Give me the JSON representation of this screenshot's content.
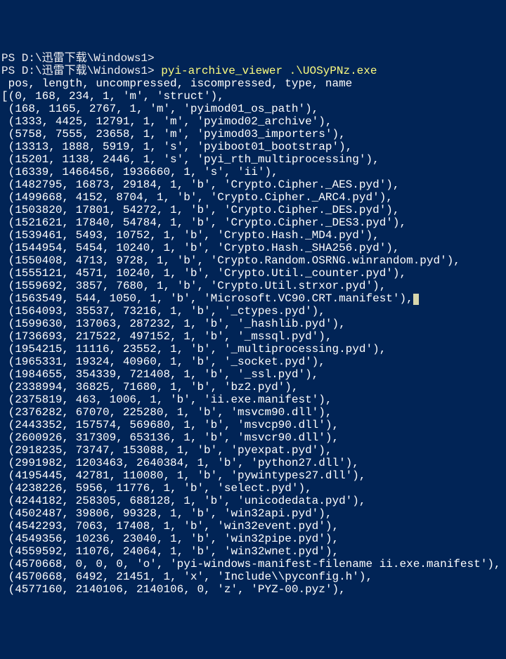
{
  "title_fragment": "PS D:\\迅雷下载\\Windows1>",
  "prompt": {
    "prefix": "PS D:\\迅雷下载\\Windows1>",
    "command": "pyi-archive_viewer .\\UOSyPNz.exe"
  },
  "header": " pos, length, uncompressed, iscompressed, type, name",
  "rows": [
    {
      "p": 0,
      "l": 168,
      "u": 234,
      "c": 1,
      "t": "m",
      "n": "struct"
    },
    {
      "p": 168,
      "l": 1165,
      "u": 2767,
      "c": 1,
      "t": "m",
      "n": "pyimod01_os_path"
    },
    {
      "p": 1333,
      "l": 4425,
      "u": 12791,
      "c": 1,
      "t": "m",
      "n": "pyimod02_archive"
    },
    {
      "p": 5758,
      "l": 7555,
      "u": 23658,
      "c": 1,
      "t": "m",
      "n": "pyimod03_importers"
    },
    {
      "p": 13313,
      "l": 1888,
      "u": 5919,
      "c": 1,
      "t": "s",
      "n": "pyiboot01_bootstrap"
    },
    {
      "p": 15201,
      "l": 1138,
      "u": 2446,
      "c": 1,
      "t": "s",
      "n": "pyi_rth_multiprocessing"
    },
    {
      "p": 16339,
      "l": 1466456,
      "u": 1936660,
      "c": 1,
      "t": "s",
      "n": "ii"
    },
    {
      "p": 1482795,
      "l": 16873,
      "u": 29184,
      "c": 1,
      "t": "b",
      "n": "Crypto.Cipher._AES.pyd"
    },
    {
      "p": 1499668,
      "l": 4152,
      "u": 8704,
      "c": 1,
      "t": "b",
      "n": "Crypto.Cipher._ARC4.pyd"
    },
    {
      "p": 1503820,
      "l": 17801,
      "u": 54272,
      "c": 1,
      "t": "b",
      "n": "Crypto.Cipher._DES.pyd"
    },
    {
      "p": 1521621,
      "l": 17840,
      "u": 54784,
      "c": 1,
      "t": "b",
      "n": "Crypto.Cipher._DES3.pyd"
    },
    {
      "p": 1539461,
      "l": 5493,
      "u": 10752,
      "c": 1,
      "t": "b",
      "n": "Crypto.Hash._MD4.pyd"
    },
    {
      "p": 1544954,
      "l": 5454,
      "u": 10240,
      "c": 1,
      "t": "b",
      "n": "Crypto.Hash._SHA256.pyd"
    },
    {
      "p": 1550408,
      "l": 4713,
      "u": 9728,
      "c": 1,
      "t": "b",
      "n": "Crypto.Random.OSRNG.winrandom.pyd"
    },
    {
      "p": 1555121,
      "l": 4571,
      "u": 10240,
      "c": 1,
      "t": "b",
      "n": "Crypto.Util._counter.pyd"
    },
    {
      "p": 1559692,
      "l": 3857,
      "u": 7680,
      "c": 1,
      "t": "b",
      "n": "Crypto.Util.strxor.pyd"
    },
    {
      "p": 1563549,
      "l": 544,
      "u": 1050,
      "c": 1,
      "t": "b",
      "n": "Microsoft.VC90.CRT.manifest",
      "cursor": true
    },
    {
      "p": 1564093,
      "l": 35537,
      "u": 73216,
      "c": 1,
      "t": "b",
      "n": "_ctypes.pyd"
    },
    {
      "p": 1599630,
      "l": 137063,
      "u": 287232,
      "c": 1,
      "t": "b",
      "n": "_hashlib.pyd"
    },
    {
      "p": 1736693,
      "l": 217522,
      "u": 497152,
      "c": 1,
      "t": "b",
      "n": "_mssql.pyd"
    },
    {
      "p": 1954215,
      "l": 11116,
      "u": 23552,
      "c": 1,
      "t": "b",
      "n": "_multiprocessing.pyd"
    },
    {
      "p": 1965331,
      "l": 19324,
      "u": 40960,
      "c": 1,
      "t": "b",
      "n": "_socket.pyd"
    },
    {
      "p": 1984655,
      "l": 354339,
      "u": 721408,
      "c": 1,
      "t": "b",
      "n": "_ssl.pyd"
    },
    {
      "p": 2338994,
      "l": 36825,
      "u": 71680,
      "c": 1,
      "t": "b",
      "n": "bz2.pyd"
    },
    {
      "p": 2375819,
      "l": 463,
      "u": 1006,
      "c": 1,
      "t": "b",
      "n": "ii.exe.manifest"
    },
    {
      "p": 2376282,
      "l": 67070,
      "u": 225280,
      "c": 1,
      "t": "b",
      "n": "msvcm90.dll"
    },
    {
      "p": 2443352,
      "l": 157574,
      "u": 569680,
      "c": 1,
      "t": "b",
      "n": "msvcp90.dll"
    },
    {
      "p": 2600926,
      "l": 317309,
      "u": 653136,
      "c": 1,
      "t": "b",
      "n": "msvcr90.dll"
    },
    {
      "p": 2918235,
      "l": 73747,
      "u": 153088,
      "c": 1,
      "t": "b",
      "n": "pyexpat.pyd"
    },
    {
      "p": 2991982,
      "l": 1203463,
      "u": 2640384,
      "c": 1,
      "t": "b",
      "n": "python27.dll"
    },
    {
      "p": 4195445,
      "l": 42781,
      "u": 110080,
      "c": 1,
      "t": "b",
      "n": "pywintypes27.dll"
    },
    {
      "p": 4238226,
      "l": 5956,
      "u": 11776,
      "c": 1,
      "t": "b",
      "n": "select.pyd"
    },
    {
      "p": 4244182,
      "l": 258305,
      "u": 688128,
      "c": 1,
      "t": "b",
      "n": "unicodedata.pyd"
    },
    {
      "p": 4502487,
      "l": 39806,
      "u": 99328,
      "c": 1,
      "t": "b",
      "n": "win32api.pyd"
    },
    {
      "p": 4542293,
      "l": 7063,
      "u": 17408,
      "c": 1,
      "t": "b",
      "n": "win32event.pyd"
    },
    {
      "p": 4549356,
      "l": 10236,
      "u": 23040,
      "c": 1,
      "t": "b",
      "n": "win32pipe.pyd"
    },
    {
      "p": 4559592,
      "l": 11076,
      "u": 24064,
      "c": 1,
      "t": "b",
      "n": "win32wnet.pyd"
    },
    {
      "p": 4570668,
      "l": 0,
      "u": 0,
      "c": 0,
      "t": "o",
      "n": "pyi-windows-manifest-filename ii.exe.manifest"
    },
    {
      "p": 4570668,
      "l": 6492,
      "u": 21451,
      "c": 1,
      "t": "x",
      "n": "Include\\\\pyconfig.h"
    },
    {
      "p": 4577160,
      "l": 2140106,
      "u": 2140106,
      "c": 0,
      "t": "z",
      "n": "PYZ-00.pyz"
    }
  ]
}
